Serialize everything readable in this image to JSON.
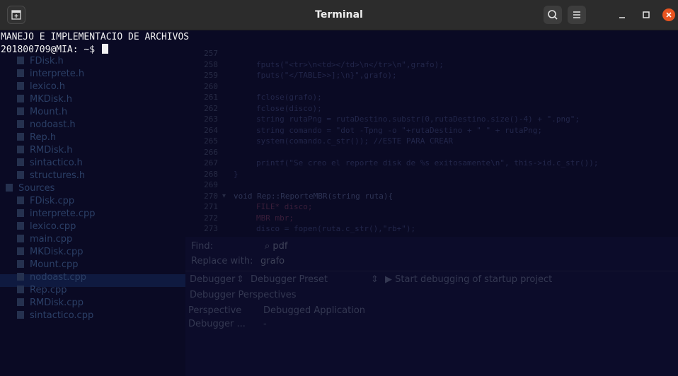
{
  "window": {
    "title": "Terminal",
    "accent": "#e95420",
    "icons": {
      "new_tab": "new-tab-icon",
      "search": "search-icon",
      "menu": "hamburger-menu-icon",
      "minimize": "minimize-icon",
      "maximize": "maximize-icon",
      "close": "close-icon"
    }
  },
  "terminal": {
    "lines": [
      "MANEJO E IMPLEMENTACIO DE ARCHIVOS",
      "201800709@MIA: ~$ "
    ]
  },
  "ghost": {
    "sidebar": {
      "header_items": [
        "FDisk.h",
        "interprete.h",
        "lexico.h",
        "MKDisk.h",
        "Mount.h",
        "nodoast.h",
        "Rep.h",
        "RMDisk.h",
        "sintactico.h",
        "structures.h"
      ],
      "sources_label": "Sources",
      "source_items": [
        "FDisk.cpp",
        "interprete.cpp",
        "lexico.cpp",
        "main.cpp",
        "MKDisk.cpp",
        "Mount.cpp",
        "nodoast.cpp",
        "Rep.cpp",
        "RMDisk.cpp",
        "sintactico.cpp"
      ],
      "selected": "Rep.cpp"
    },
    "editor": {
      "line_numbers": [
        "257",
        "258",
        "259",
        "260",
        "261",
        "262",
        "263",
        "264",
        "265",
        "266",
        "267",
        "268",
        "269",
        "270",
        "271",
        "272",
        "273"
      ],
      "code": [
        "",
        "fputs(\"<tr>\\n<td></td>\\n</tr>\\n\",grafo);",
        "fputs(\"</TABLE>>];\\n}\",grafo);",
        "",
        "fclose(grafo);",
        "fclose(disco);",
        "string rutaPng = rutaDestino.substr(0,rutaDestino.size()-4) + \".png\";",
        "string comando = \"dot -Tpng -o \"+rutaDestino + \" \" + rutaPng;",
        "system(comando.c_str()); //ESTE PARA CREAR",
        "",
        "printf(\"Se creo el reporte disk de %s exitosamente\\n\", this->id.c_str());",
        "}",
        "",
        "void Rep::ReporteMBR(string ruta){",
        "FILE* disco;",
        "MBR mbr;",
        "disco = fopen(ruta.c_str(),\"rb+\");"
      ]
    },
    "panel": {
      "find_label": "Find:",
      "find_value": "pdf",
      "replace_label": "Replace with:",
      "replace_value": "grafo",
      "debugger_label": "Debugger",
      "debugger_preset": "Debugger Preset",
      "start_debugging": "Start debugging of startup project",
      "perspectives": "Debugger Perspectives",
      "perspective_label": "Perspective",
      "perspective_value": "Debugged Application",
      "debugger_dots": "Debugger ...",
      "debugger_dots_value": "-"
    }
  }
}
